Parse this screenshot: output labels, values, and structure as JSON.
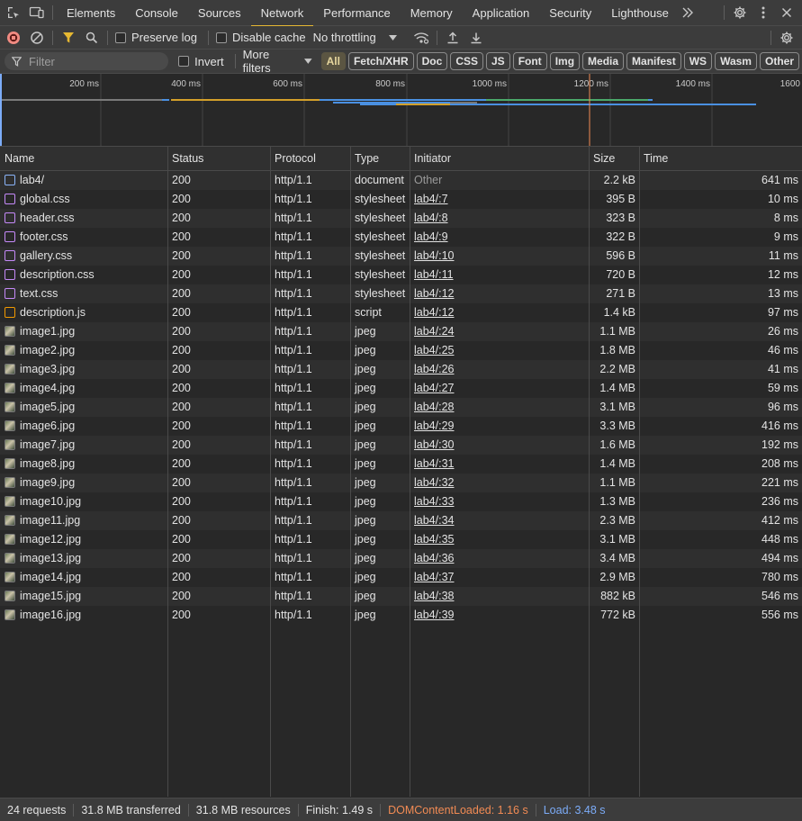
{
  "tabs": [
    "Elements",
    "Console",
    "Sources",
    "Network",
    "Performance",
    "Memory",
    "Application",
    "Security",
    "Lighthouse"
  ],
  "active_tab": "Network",
  "toolbar": {
    "preserve_log": "Preserve log",
    "disable_cache": "Disable cache",
    "throttling": "No throttling"
  },
  "filter": {
    "placeholder": "Filter",
    "invert": "Invert",
    "more_filters": "More filters",
    "types": [
      "All",
      "Fetch/XHR",
      "Doc",
      "CSS",
      "JS",
      "Font",
      "Img",
      "Media",
      "Manifest",
      "WS",
      "Wasm",
      "Other"
    ]
  },
  "overview": {
    "ticks": [
      "200 ms",
      "400 ms",
      "600 ms",
      "800 ms",
      "1000 ms",
      "1200 ms",
      "1400 ms",
      "1600"
    ]
  },
  "columns": [
    "Name",
    "Status",
    "Protocol",
    "Type",
    "Initiator",
    "Size",
    "Time"
  ],
  "requests": [
    {
      "name": "lab4/",
      "status": "200",
      "protocol": "http/1.1",
      "type": "document",
      "initiator": "Other",
      "size": "2.2 kB",
      "time": "641 ms",
      "icon": "document"
    },
    {
      "name": "global.css",
      "status": "200",
      "protocol": "http/1.1",
      "type": "stylesheet",
      "initiator": "lab4/:7",
      "size": "395 B",
      "time": "10 ms",
      "icon": "stylesheet"
    },
    {
      "name": "header.css",
      "status": "200",
      "protocol": "http/1.1",
      "type": "stylesheet",
      "initiator": "lab4/:8",
      "size": "323 B",
      "time": "8 ms",
      "icon": "stylesheet"
    },
    {
      "name": "footer.css",
      "status": "200",
      "protocol": "http/1.1",
      "type": "stylesheet",
      "initiator": "lab4/:9",
      "size": "322 B",
      "time": "9 ms",
      "icon": "stylesheet"
    },
    {
      "name": "gallery.css",
      "status": "200",
      "protocol": "http/1.1",
      "type": "stylesheet",
      "initiator": "lab4/:10",
      "size": "596 B",
      "time": "11 ms",
      "icon": "stylesheet"
    },
    {
      "name": "description.css",
      "status": "200",
      "protocol": "http/1.1",
      "type": "stylesheet",
      "initiator": "lab4/:11",
      "size": "720 B",
      "time": "12 ms",
      "icon": "stylesheet"
    },
    {
      "name": "text.css",
      "status": "200",
      "protocol": "http/1.1",
      "type": "stylesheet",
      "initiator": "lab4/:12",
      "size": "271 B",
      "time": "13 ms",
      "icon": "stylesheet"
    },
    {
      "name": "description.js",
      "status": "200",
      "protocol": "http/1.1",
      "type": "script",
      "initiator": "lab4/:12",
      "size": "1.4 kB",
      "time": "97 ms",
      "icon": "script"
    },
    {
      "name": "image1.jpg",
      "status": "200",
      "protocol": "http/1.1",
      "type": "jpeg",
      "initiator": "lab4/:24",
      "size": "1.1 MB",
      "time": "26 ms",
      "icon": "image"
    },
    {
      "name": "image2.jpg",
      "status": "200",
      "protocol": "http/1.1",
      "type": "jpeg",
      "initiator": "lab4/:25",
      "size": "1.8 MB",
      "time": "46 ms",
      "icon": "image"
    },
    {
      "name": "image3.jpg",
      "status": "200",
      "protocol": "http/1.1",
      "type": "jpeg",
      "initiator": "lab4/:26",
      "size": "2.2 MB",
      "time": "41 ms",
      "icon": "image"
    },
    {
      "name": "image4.jpg",
      "status": "200",
      "protocol": "http/1.1",
      "type": "jpeg",
      "initiator": "lab4/:27",
      "size": "1.4 MB",
      "time": "59 ms",
      "icon": "image"
    },
    {
      "name": "image5.jpg",
      "status": "200",
      "protocol": "http/1.1",
      "type": "jpeg",
      "initiator": "lab4/:28",
      "size": "3.1 MB",
      "time": "96 ms",
      "icon": "image"
    },
    {
      "name": "image6.jpg",
      "status": "200",
      "protocol": "http/1.1",
      "type": "jpeg",
      "initiator": "lab4/:29",
      "size": "3.3 MB",
      "time": "416 ms",
      "icon": "image"
    },
    {
      "name": "image7.jpg",
      "status": "200",
      "protocol": "http/1.1",
      "type": "jpeg",
      "initiator": "lab4/:30",
      "size": "1.6 MB",
      "time": "192 ms",
      "icon": "image"
    },
    {
      "name": "image8.jpg",
      "status": "200",
      "protocol": "http/1.1",
      "type": "jpeg",
      "initiator": "lab4/:31",
      "size": "1.4 MB",
      "time": "208 ms",
      "icon": "image"
    },
    {
      "name": "image9.jpg",
      "status": "200",
      "protocol": "http/1.1",
      "type": "jpeg",
      "initiator": "lab4/:32",
      "size": "1.1 MB",
      "time": "221 ms",
      "icon": "image"
    },
    {
      "name": "image10.jpg",
      "status": "200",
      "protocol": "http/1.1",
      "type": "jpeg",
      "initiator": "lab4/:33",
      "size": "1.3 MB",
      "time": "236 ms",
      "icon": "image"
    },
    {
      "name": "image11.jpg",
      "status": "200",
      "protocol": "http/1.1",
      "type": "jpeg",
      "initiator": "lab4/:34",
      "size": "2.3 MB",
      "time": "412 ms",
      "icon": "image"
    },
    {
      "name": "image12.jpg",
      "status": "200",
      "protocol": "http/1.1",
      "type": "jpeg",
      "initiator": "lab4/:35",
      "size": "3.1 MB",
      "time": "448 ms",
      "icon": "image"
    },
    {
      "name": "image13.jpg",
      "status": "200",
      "protocol": "http/1.1",
      "type": "jpeg",
      "initiator": "lab4/:36",
      "size": "3.4 MB",
      "time": "494 ms",
      "icon": "image"
    },
    {
      "name": "image14.jpg",
      "status": "200",
      "protocol": "http/1.1",
      "type": "jpeg",
      "initiator": "lab4/:37",
      "size": "2.9 MB",
      "time": "780 ms",
      "icon": "image"
    },
    {
      "name": "image15.jpg",
      "status": "200",
      "protocol": "http/1.1",
      "type": "jpeg",
      "initiator": "lab4/:38",
      "size": "882 kB",
      "time": "546 ms",
      "icon": "image"
    },
    {
      "name": "image16.jpg",
      "status": "200",
      "protocol": "http/1.1",
      "type": "jpeg",
      "initiator": "lab4/:39",
      "size": "772 kB",
      "time": "556 ms",
      "icon": "image"
    }
  ],
  "status_bar": {
    "requests": "24 requests",
    "transferred": "31.8 MB transferred",
    "resources": "31.8 MB resources",
    "finish": "Finish: 1.49 s",
    "dom_content_loaded": "DOMContentLoaded: 1.16 s",
    "load": "Load: 3.48 s"
  },
  "colors": {
    "accent": "#e6b832",
    "dom_content_loaded": "#f28b54",
    "load": "#7cacf8",
    "record": "#f28b82",
    "document_icon": "#8ab4f8",
    "stylesheet_icon": "#c58af9",
    "script_icon": "#f29900"
  }
}
